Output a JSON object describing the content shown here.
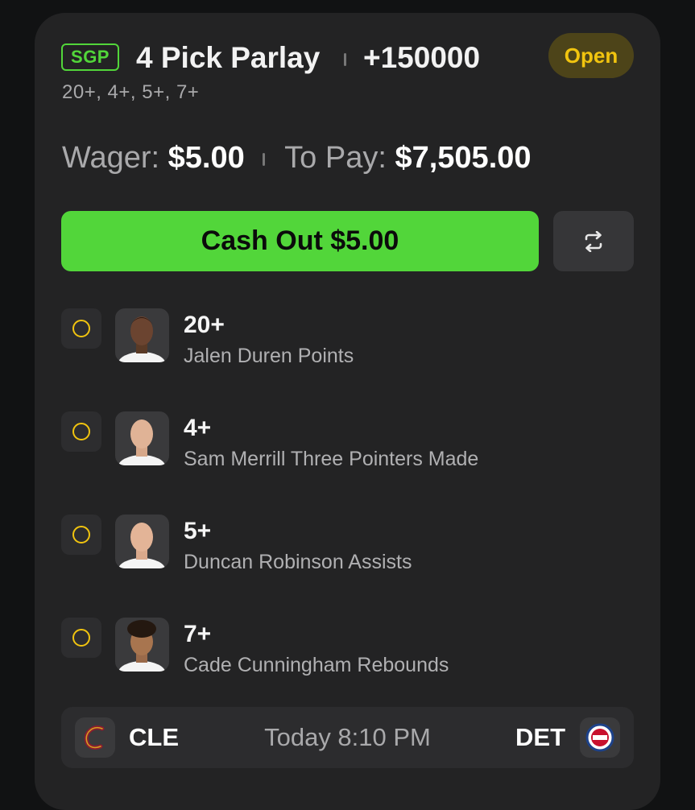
{
  "bet": {
    "badge": "SGP",
    "title": "4 Pick Parlay",
    "odds": "+150000",
    "status": "Open",
    "subtitle": "20+, 4+, 5+, 7+",
    "wager_label": "Wager:",
    "wager_value": "$5.00",
    "topay_label": "To Pay:",
    "topay_value": "$7,505.00",
    "cashout_label": "Cash Out $5.00",
    "colors": {
      "accent_green": "#52d63a",
      "pending_yellow": "#f1c40f",
      "card_bg": "#232324"
    }
  },
  "legs": [
    {
      "line": "20+",
      "description": "Jalen Duren Points",
      "icon": "player-headshot"
    },
    {
      "line": "4+",
      "description": "Sam Merrill Three Pointers Made",
      "icon": "player-headshot"
    },
    {
      "line": "5+",
      "description": "Duncan Robinson Assists",
      "icon": "player-headshot"
    },
    {
      "line": "7+",
      "description": "Cade Cunningham Rebounds",
      "icon": "player-headshot"
    }
  ],
  "game": {
    "away_abbr": "CLE",
    "home_abbr": "DET",
    "time": "Today 8:10 PM",
    "away_logo_icon": "cavaliers-logo",
    "home_logo_icon": "pistons-logo"
  }
}
